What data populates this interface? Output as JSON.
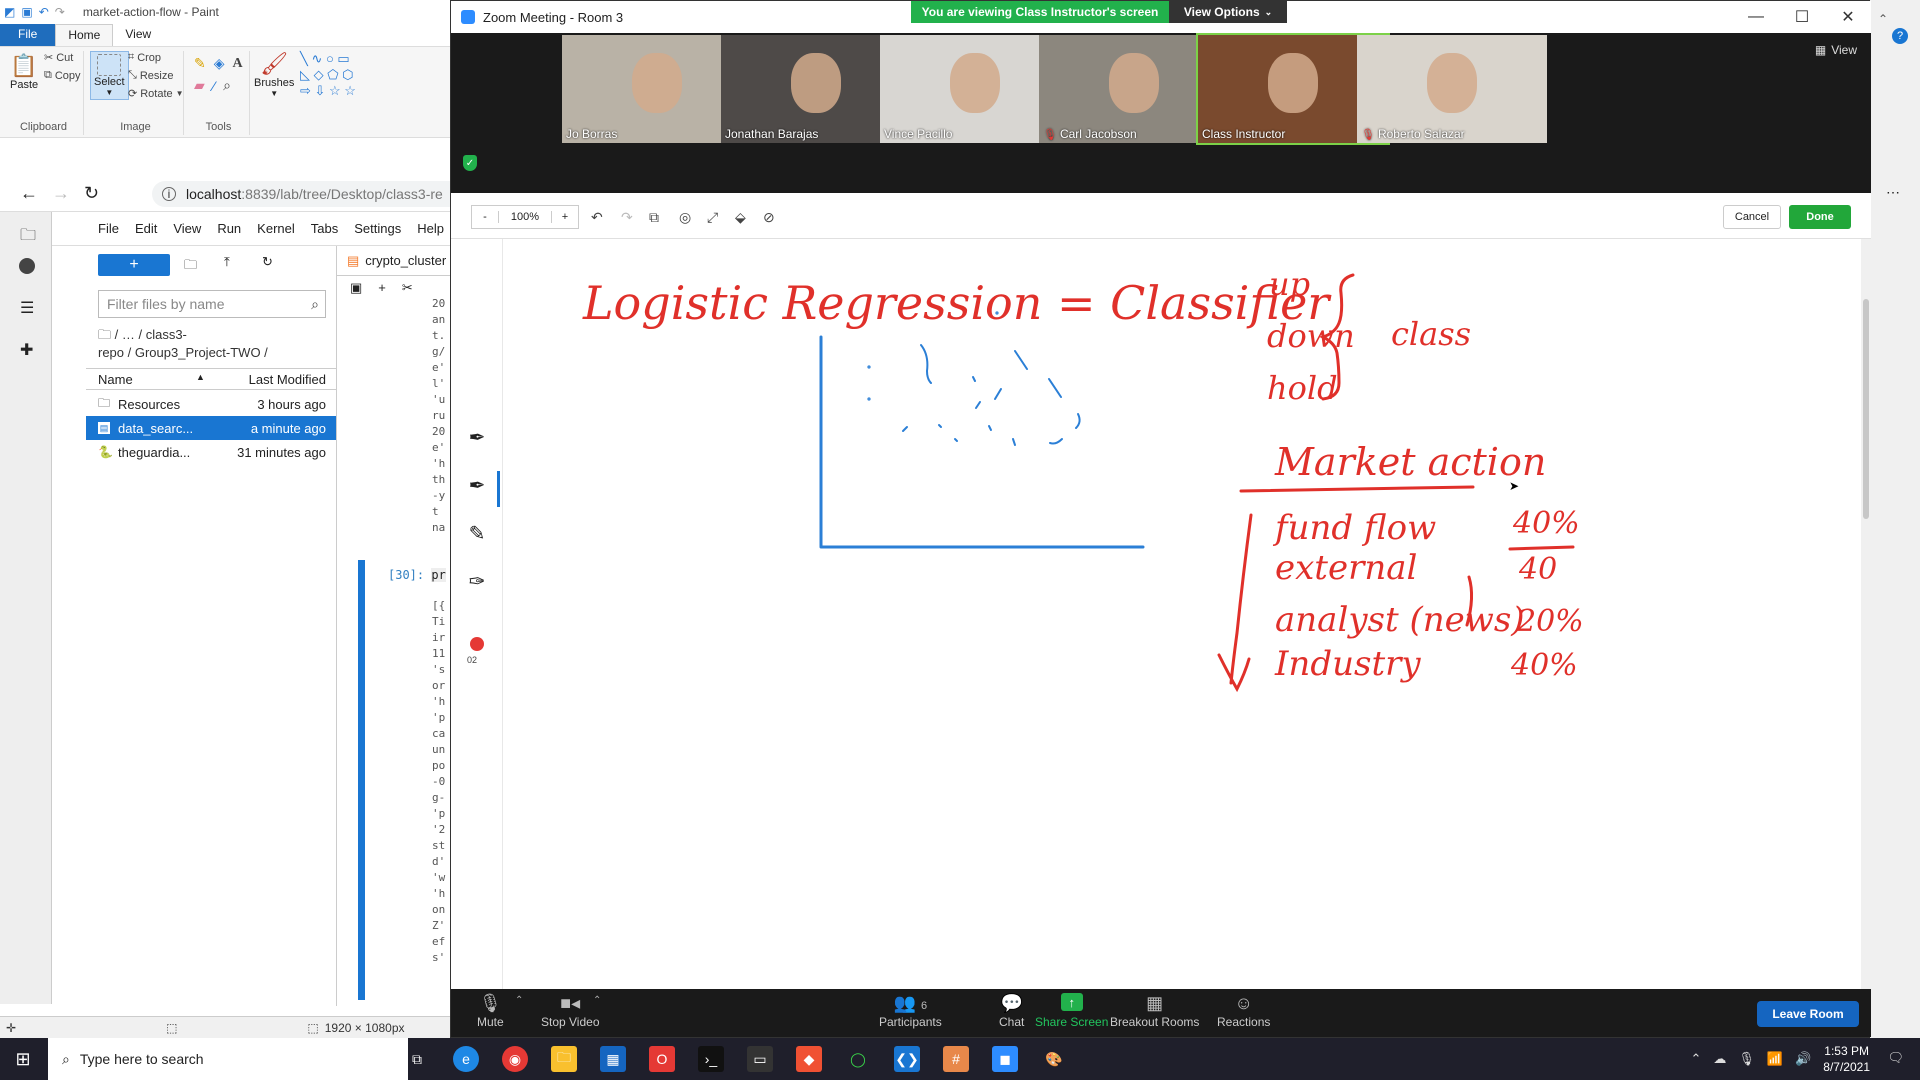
{
  "paint": {
    "title": "market-action-flow - Paint",
    "file_tab": "File",
    "tabs": [
      "Home",
      "View"
    ],
    "clipboard": {
      "paste": "Paste",
      "cut": "Cut",
      "copy": "Copy",
      "label": "Clipboard"
    },
    "image": {
      "select": "Select",
      "crop": "Crop",
      "resize": "Resize",
      "rotate": "Rotate",
      "label": "Image"
    },
    "tools_label": "Tools",
    "brushes": "Brushes",
    "status": {
      "dimensions": "1920 × 1080px"
    }
  },
  "browser": {
    "url_host": "localhost",
    "url_path": ":8839/lab/tree/Desktop/class3-re"
  },
  "jupyter": {
    "menu": [
      "File",
      "Edit",
      "View",
      "Run",
      "Kernel",
      "Tabs",
      "Settings",
      "Help"
    ],
    "new_button": "+",
    "filter_placeholder": "Filter files by name",
    "breadcrumb_line1": "/  …  / class3-",
    "breadcrumb_line2": "repo / Group3_Project-TWO /",
    "columns": {
      "name": "Name",
      "modified": "Last Modified"
    },
    "files": [
      {
        "name": "Resources",
        "modified": "3 hours ago",
        "icon": "folder-icon",
        "selected": false
      },
      {
        "name": "data_searc...",
        "modified": "a minute ago",
        "icon": "notebook-icon",
        "selected": true
      },
      {
        "name": "theguardia...",
        "modified": "31 minutes ago",
        "icon": "python-file-icon",
        "selected": false
      }
    ],
    "notebook_tab": "crypto_cluster",
    "code_lines": [
      "20",
      "an",
      "t.",
      "g/",
      "e'",
      "l'",
      "'u",
      "ru",
      "20",
      "e'",
      "'h",
      "th",
      "-y",
      "t ",
      "na"
    ],
    "prompt": "[30]:",
    "prompt_code": "pr",
    "output_lines": [
      "[{",
      "Ti",
      "ir",
      "11",
      "'s",
      "or",
      "'h",
      "'p",
      "ca",
      "un",
      "po",
      "-0",
      "g-",
      "'p",
      "'2",
      "st",
      "d'",
      "'w",
      "'h",
      "on",
      "Z'",
      "ef",
      "s'"
    ]
  },
  "zoom": {
    "title": "Zoom Meeting - Room 3",
    "viewing_banner": "You are viewing Class Instructor's screen",
    "view_options": "View Options",
    "view_label": "View",
    "participants": [
      {
        "name": "Jo Borras",
        "muted": false,
        "active": false,
        "color": "#b9b2a6"
      },
      {
        "name": "Jonathan Barajas",
        "muted": false,
        "active": false,
        "color": "#4e4a48"
      },
      {
        "name": "Vince Pacillo",
        "muted": false,
        "active": false,
        "color": "#d8d6d2"
      },
      {
        "name": "Carl Jacobson",
        "muted": true,
        "active": false,
        "color": "#8c877e"
      },
      {
        "name": "Class Instructor",
        "muted": false,
        "active": true,
        "color": "#7a4a2e"
      },
      {
        "name": "Roberto Salazar",
        "muted": true,
        "active": false,
        "color": "#d9d4cc"
      }
    ],
    "annotation": {
      "zoom_level": "100%",
      "minus": "-",
      "plus": "+",
      "cancel": "Cancel",
      "done": "Done",
      "record_count": "02"
    },
    "whiteboard": {
      "title": "Logistic Regression = Classifier",
      "brace_items": [
        "up",
        "down",
        "hold"
      ],
      "brace_label": "class",
      "heading": "Market action",
      "factors": [
        {
          "name": "fund flow",
          "weight": "40%"
        },
        {
          "name": "external",
          "weight": "40"
        },
        {
          "name": "analyst (news)",
          "weight": "20%"
        },
        {
          "name": "Industry",
          "weight": "40%"
        }
      ]
    },
    "bottom": {
      "mute": "Mute",
      "stop_video": "Stop Video",
      "participants": "Participants",
      "participants_count": "6",
      "chat": "Chat",
      "share_screen": "Share Screen",
      "breakout": "Breakout Rooms",
      "reactions": "Reactions",
      "leave": "Leave Room"
    }
  },
  "taskbar": {
    "search_placeholder": "Type here to search",
    "time": "1:53 PM",
    "date": "8/7/2021"
  },
  "colors": {
    "accent_blue": "#1976d2",
    "zoom_green": "#22b14c",
    "ink_red": "#e0302a",
    "ink_blue": "#2b7fd6"
  }
}
